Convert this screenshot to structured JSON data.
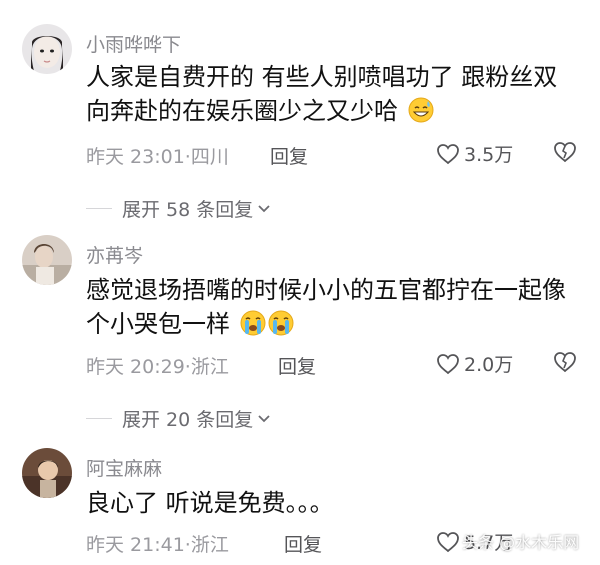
{
  "comments": [
    {
      "username": "小雨哗哗下",
      "text": "人家是自费开的 有些人别喷唱功了 跟粉丝双向奔赴的在娱乐圈少之又少哈",
      "emoji": "grinning-sweat-emoji",
      "time_location": "昨天 23:01·四川",
      "reply_label": "回复",
      "likes": "3.5万",
      "expand_label": "展开 58 条回复"
    },
    {
      "username": "亦苒岑",
      "text": "感觉退场捂嘴的时候小小的五官都拧在一起像个小哭包一样",
      "emoji": "loudly-crying-emoji x2",
      "time_location": "昨天 20:29·浙江",
      "reply_label": "回复",
      "likes": "2.0万",
      "expand_label": "展开 20 条回复"
    },
    {
      "username": "阿宝麻麻",
      "text": "良心了 听说是免费。。。",
      "time_location": "昨天 21:41·浙江",
      "reply_label": "回复",
      "likes": "5.7万"
    }
  ],
  "icons": {
    "like": "heart-outline-icon",
    "dislike": "broken-heart-icon",
    "expand": "chevron-down-icon"
  },
  "colors": {
    "text_primary": "#111111",
    "text_secondary": "#9a9a9f",
    "username": "#8a8a8f",
    "action": "#555558"
  },
  "watermark": {
    "text": "头条 @水木乐网"
  }
}
